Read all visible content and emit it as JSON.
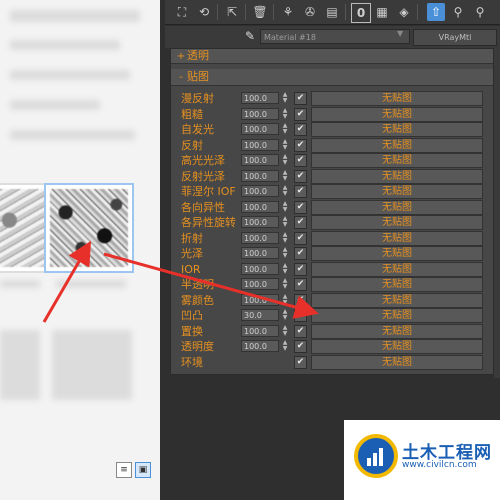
{
  "toolbar": {
    "icons": [
      "pick-material-icon",
      "get-material-icon",
      "assign-icon",
      "delete-icon",
      "material-map-icon",
      "show-map-icon",
      "save-icon",
      "material-id-icon",
      "show-background-icon",
      "show-end-result-icon",
      "go-parent-icon",
      "go-forward-icon"
    ]
  },
  "material": {
    "name": "Material #18",
    "type": "VRayMtl"
  },
  "rollouts": {
    "transparency": "透明",
    "maps": "贴图"
  },
  "map_rows": [
    {
      "label": "漫反射",
      "value": "100.0",
      "checked": true,
      "map": "无贴图"
    },
    {
      "label": "粗糙",
      "value": "100.0",
      "checked": true,
      "map": "无贴图"
    },
    {
      "label": "自发光",
      "value": "100.0",
      "checked": true,
      "map": "无贴图"
    },
    {
      "label": "反射",
      "value": "100.0",
      "checked": true,
      "map": "无贴图"
    },
    {
      "label": "高光光泽",
      "value": "100.0",
      "checked": true,
      "map": "无贴图"
    },
    {
      "label": "反射光泽",
      "value": "100.0",
      "checked": true,
      "map": "无贴图"
    },
    {
      "label": "菲涅尔 IOF",
      "value": "100.0",
      "checked": true,
      "map": "无贴图"
    },
    {
      "label": "各向异性",
      "value": "100.0",
      "checked": true,
      "map": "无贴图"
    },
    {
      "label": "各异性旋转",
      "value": "100.0",
      "checked": true,
      "map": "无贴图"
    },
    {
      "label": "折射",
      "value": "100.0",
      "checked": true,
      "map": "无贴图"
    },
    {
      "label": "光泽",
      "value": "100.0",
      "checked": true,
      "map": "无贴图"
    },
    {
      "label": "IOR",
      "value": "100.0",
      "checked": true,
      "map": "无贴图"
    },
    {
      "label": "半透明",
      "value": "100.0",
      "checked": true,
      "map": "无贴图"
    },
    {
      "label": "雾颜色",
      "value": "100.0",
      "checked": true,
      "map": "无贴图"
    },
    {
      "label": "凹凸",
      "value": "30.0",
      "checked": true,
      "map": "无贴图"
    },
    {
      "label": "置换",
      "value": "100.0",
      "checked": true,
      "map": "无贴图"
    },
    {
      "label": "透明度",
      "value": "100.0",
      "checked": true,
      "map": "无贴图"
    },
    {
      "label": "环境",
      "value": "",
      "checked": true,
      "map": "无贴图"
    }
  ],
  "watermark": {
    "title": "土木工程网",
    "url": "www.civilcn.com"
  },
  "colors": {
    "accent": "#e59020",
    "panel": "#474747",
    "arrow": "#e8302a",
    "selection": "#9cc6ef"
  }
}
